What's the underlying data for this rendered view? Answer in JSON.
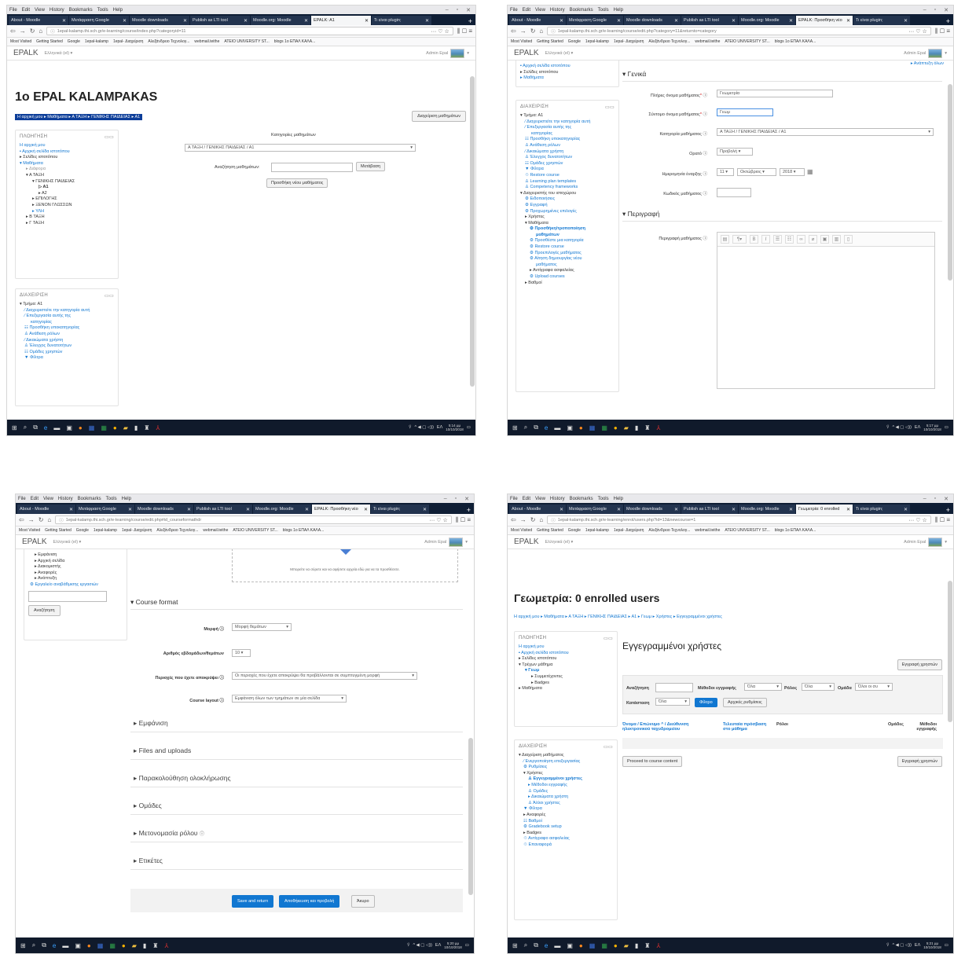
{
  "browser": {
    "menu": [
      "File",
      "Edit",
      "View",
      "History",
      "Bookmarks",
      "Tools",
      "Help"
    ],
    "tabs": [
      "About - Moodle",
      "Μετάφραση Google",
      "Moodle downloads",
      "Publish as LTI tool",
      "Moodle.org: Moodle",
      "EPALK: A1",
      "Τι είναι plugin;"
    ],
    "bookmarks": [
      "Most Visited",
      "Getting Started",
      "Google",
      "1epal-kalamp",
      "1epal- Διαχείριση",
      "Αλεξάνδρειο Τεχνολογ...",
      "webmail.teithe",
      "ATEIO UNIVERSITY ST...",
      "blogs 1o ΕΠΑΛ ΚΑΛΑ..."
    ]
  },
  "site": {
    "brand": "EPALK",
    "lang": "Ελληνικά (el) ▾",
    "user": "Admin Epal"
  },
  "taskbar": {
    "lang": "EΛ"
  },
  "s1": {
    "url": "1epal-kalamp.thi.sch.gr/e-learning/course/index.php?categoryid=11",
    "active_tab": "EPALK: A1",
    "time": "5:14 μμ",
    "date": "10/10/2018",
    "title": "1o EPAL KALAMPAKAS",
    "crumbs": "Η αρχική μου ▸ Μαθήματα ▸ Α ΤΑΞΗ ▸ ΓΕΝΙΚΗΣ ΠΑΙΔΕΙΑΣ ▸ Α1",
    "manage_btn": "Διαχείριση μαθημάτων",
    "nav_title": "ΠΛΟΗΓΗΣΗ",
    "nav": [
      "Η αρχική μου",
      "▪ Αρχική σελίδα ιστοτόπου",
      "▸ Σελίδες ιστοτόπου",
      "▾ Μαθήματα",
      "▸ Διάφορα",
      "▾ Α ΤΑΞΗ",
      "▾ ΓΕΝΙΚΗΣ ΠΑΙΔΕΙΑΣ",
      "▷ Α1",
      "▸ Α2",
      "▸ ΕΠΙΛΟΓΗΣ",
      "▸ ΞΕΝΟΝ ΓΛΩΣΣΩΝ",
      "▸ ΥΛΗ",
      "▸ Β ΤΑΞΗ",
      "▸ Γ ΤΑΞΗ"
    ],
    "admin_title": "ΔΙΑΧΕΙΡΙΣΗ",
    "admin": [
      "▾ Τμήμα: Α1",
      "⁄ Διαχειριστείτε την κατηγορία αυτή",
      "⁄ Επεξεργασία αυτής της",
      "κατηγορίας",
      "☷ Προσθήκη υποκατηγορίας",
      "♙ Ανάθεση ρόλων",
      "⁄ Δικαιώματα χρήστη",
      "♙ Έλεγχος δυνατοτήτων",
      "☷ Ομάδες χρηστών",
      "▼ Φίλτρα"
    ],
    "cat_label": "Κατηγορίες μαθημάτων",
    "cat_select": "Α ΤΑΞΗ / ΓΕΝΙΚΗΣ ΠΑΙΔΕΙΑΣ / Α1",
    "search_label": "Αναζήτηση μαθημάτων:",
    "search_btn": "Μετάβαση",
    "add_btn": "Προσθήκη νέου μαθήματος"
  },
  "s2": {
    "url": "1epal-kalamp.thi.sch.gr/e-learning/course/edit.php?category=11&returnto=category",
    "active_tab": "EPALK: Προσθήκη νέο",
    "time": "5:17 μμ",
    "date": "10/10/2018",
    "expand": "▸ Ανάπτυξη όλων",
    "nav": [
      "▪ Αρχική σελίδα ιστοτόπου",
      "▸ Σελίδες ιστοτόπου",
      "▸ Μαθήματα"
    ],
    "admin_title": "ΔΙΑΧΕΙΡΙΣΗ",
    "admin": [
      "▾ Τμήμα: Α1",
      "⁄ Διαχειριστείτε την κατηγορία αυτή",
      "⁄ Επεξεργασία αυτής της",
      "κατηγορίας",
      "☷ Προσθήκη υποκατηγορίας",
      "♙ Ανάθεση ρόλων",
      "⁄ Δικαιώματα χρήστη",
      "♙ Έλεγχος δυνατοτήτων",
      "☷ Ομάδες χρηστών",
      "▼ Φίλτρα",
      "♲ Restore course",
      "♙ Learning plan templates",
      "♙ Competency frameworks",
      "",
      "▾ Διαχειριστής του ιστοχώρου",
      "⚙ Ειδοποιήσεις",
      "⚙ Εγγραφή",
      "⚙ Προχωρημένες επιλογές",
      "▸ Χρήστες",
      "▾ Μαθήματα",
      "⚙ Προσθήκη/τροποποίηση",
      "μαθημάτων",
      "⚙ Προσθέστε μια κατηγορία",
      "⚙ Restore course",
      "⚙ Προεπιλογές μαθήματος",
      "⚙ Αίτηση δημιουργίας νέου",
      "μαθήματος",
      "▸ Αντίγραφα ασφαλείας",
      "⚙ Upload courses",
      "▸ Βαθμοί"
    ],
    "sec_general": "Γενικά",
    "l_fullname": "Πλήρες όνομα μαθήματος",
    "v_fullname": "Γεωμετρία",
    "l_short": "Σύντομο όνομα μαθήματος",
    "v_short": "Γεωμ",
    "l_cat": "Κατηγορία μαθήματος",
    "v_cat": "Α ΤΑΞΗ / ΓΕΝΙΚΗΣ ΠΑΙΔΕΙΑΣ / Α1",
    "l_visible": "Ορατό",
    "v_visible": "Προβολή",
    "l_start": "Ημερομηνία έναρξης",
    "v_day": "11",
    "v_month": "Οκτώβριος",
    "v_year": "2018",
    "l_id": "Κωδικός μαθήματος",
    "sec_desc": "Περιγραφή",
    "l_desc": "Περιγραφή μαθήματος"
  },
  "s3": {
    "url": "1epal-kalamp.thi.sch.gr/e-learning/course/edit.php#id_courseformathdr",
    "active_tab": "EPALK: Προσθήκη νέο",
    "time": "5:20 μμ",
    "date": "10/10/2018",
    "nav": [
      "▸ Εμφάνιση",
      "▸ Αρχική σελίδα",
      "▸ Διακομιστής",
      "▸ Αναφορές",
      "▸ Ανάπτυξη",
      "⚙ Εργαλείο αναβάθμισης εργασιών"
    ],
    "search_btn": "Αναζήτηση",
    "drop_text": "Μπορείτε να σύρετε και να αφήσετε αρχεία εδώ για να τα προσθέσετε.",
    "sec_format": "Course format",
    "l_format": "Μορφή",
    "v_format": "Μορφή θεμάτων",
    "l_sections": "Αριθμός εβδομάδων/θεμάτων",
    "v_sections": "10",
    "l_hidden": "Περιοχές που έχετε αποκρύψει",
    "v_hidden": "Οι περιοχές που έχετε αποκρύψει θα προβάλλονται σε συμπτυγμένη μορφή",
    "l_layout": "Course layout",
    "v_layout": "Εμφάνιση όλων των τμημάτων σε μία σελίδα",
    "rows": [
      "Εμφάνιση",
      "Files and uploads",
      "Παρακολούθηση ολοκλήρωσης",
      "Ομάδες",
      "Μετονομασία ρόλου",
      "Ετικέτες"
    ],
    "btn_save_return": "Save and return",
    "btn_save_view": "Αποθήκευση και προβολή",
    "btn_cancel": "Άκυρο"
  },
  "s4": {
    "url": "1epal-kalamp.thi.sch.gr/e-learning/enrol/users.php?id=13&newcourse=1",
    "active_tab": "Γεωμετρία: 0 enrolled",
    "time": "5:21 μμ",
    "date": "10/10/2018",
    "title": "Γεωμετρία: 0 enrolled users",
    "crumbs": "Η αρχική μου ▸ Μαθήματα ▸ Α ΤΑΞΗ ▸ ΓΕΝΙΚΗΣ ΠΑΙΔΕΙΑΣ ▸ Α1 ▸ Γεωμ ▸ Χρήστες ▸ Εγγεγραμμένοι χρήστες",
    "nav_title": "ΠΛΟΗΓΗΣΗ",
    "nav": [
      "Η αρχική μου",
      "▪ Αρχική σελίδα ιστοτόπου",
      "▸ Σελίδες ιστοτόπου",
      "▾ Τρέχων μάθημα",
      "▾ Γεωμ",
      "▸ Συμμετέχοντες",
      "▸ Badges",
      "▸ Μαθήματα"
    ],
    "admin_title": "ΔΙΑΧΕΙΡΙΣΗ",
    "admin": [
      "▾ Διαχείριση μαθήματος",
      "⁄ Ενεργοποίηση επεξεργασίας",
      "⚙ Ρυθμίσεις",
      "▾ Χρήστες",
      "♙ Εγγεγραμμένοι χρήστες",
      "▸ Μέθοδοι εγγραφής",
      "♙ Ομάδες",
      "▸ Δικαιώματα χρήστη",
      "♙ Άλλοι χρήστες",
      "▼ Φίλτρα",
      "▸ Αναφορές",
      "☷ Βαθμοί",
      "⚙ Gradebook setup",
      "▸ Badges",
      "♲ Αντίγραφο ασφαλείας",
      "♲ Επαναφορά"
    ],
    "h2": "Εγγεγραμμένοι χρήστες",
    "enrol_btn": "Εγγραφή χρηστών",
    "f_search": "Αναζήτηση",
    "f_methods": "Μέθοδοι εγγραφής",
    "f_methods_v": "Όλα",
    "f_role": "Ρόλος",
    "f_role_v": "Όλα",
    "f_group": "Ομάδα",
    "f_group_v": "Όλοι οι συ",
    "f_status": "Κατάσταση",
    "f_status_v": "Όλα",
    "f_filter": "Φίλτρο",
    "f_reset": "Αρχικές ρυθμίσεις",
    "col1": "Όνομα / Επώνυμο ^ / Διεύθυνση ηλεκτρονικού ταχυδρομείου",
    "col2": "Τελευταία πρόσβαση στο μάθημα",
    "col3": "Ρόλοι",
    "col4": "Ομάδες",
    "col5": "Μέθοδοι εγγραφής",
    "proceed": "Proceed to course content"
  }
}
